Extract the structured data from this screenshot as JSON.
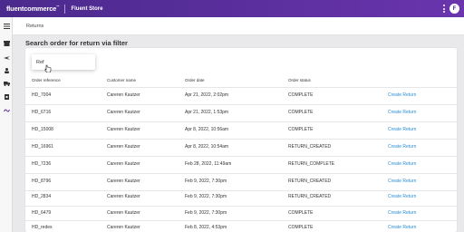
{
  "app": {
    "logo_text": "fluentcommerce",
    "logo_mark": "™",
    "store_name": "Fluent Store",
    "avatar_initial": "F"
  },
  "sidebar": {
    "icons": [
      "menu-icon",
      "store-icon",
      "plane-icon",
      "person-icon",
      "truck-icon",
      "clipboard-icon",
      "returns-icon"
    ]
  },
  "breadcrumb": "Returns",
  "page_title": "Search order for return via filter",
  "search": {
    "value": "Ref"
  },
  "table": {
    "columns": [
      "Order reference",
      "Customer name",
      "Order date",
      "Order status"
    ],
    "rows": [
      {
        "ref": "HD_7004",
        "customer": "Careren Kautzer",
        "date": "Apr 21, 2022, 2:02pm",
        "status": "COMPLETE",
        "action": "Create Return"
      },
      {
        "ref": "HD_6716",
        "customer": "Careren Kautzer",
        "date": "Apr 21, 2022, 1:53pm",
        "status": "COMPLETE",
        "action": "Create Return"
      },
      {
        "ref": "HD_15008",
        "customer": "Careren Kautzer",
        "date": "Apr 8, 2022, 10:56am",
        "status": "COMPLETE",
        "action": "Create Return"
      },
      {
        "ref": "HD_16961",
        "customer": "Careren Kautzer",
        "date": "Apr 8, 2022, 10:54am",
        "status": "RETURN_CREATED",
        "action": "Create Return"
      },
      {
        "ref": "HD_7236",
        "customer": "Careren Kautzer",
        "date": "Feb 28, 2022, 11:49am",
        "status": "RETURN_COMPLETE",
        "action": "Create Return"
      },
      {
        "ref": "HD_8796",
        "customer": "Careren Kautzer",
        "date": "Feb 9, 2022, 7:30pm",
        "status": "RETURN_CREATED",
        "action": "Create Return"
      },
      {
        "ref": "HD_2834",
        "customer": "Careren Kautzer",
        "date": "Feb 9, 2022, 7:30pm",
        "status": "RETURN_CREATED",
        "action": "Create Return"
      },
      {
        "ref": "HD_6479",
        "customer": "Careren Kautzer",
        "date": "Feb 9, 2022, 7:30pm",
        "status": "COMPLETE",
        "action": "Create Return"
      },
      {
        "ref": "HD_redes",
        "customer": "Careren Kautzer",
        "date": "Feb 8, 2022, 4:53pm",
        "status": "COMPLETE",
        "action": "Create Return"
      }
    ]
  },
  "colors": {
    "topbar": "#4a2a8c",
    "link": "#2a8ed6"
  }
}
